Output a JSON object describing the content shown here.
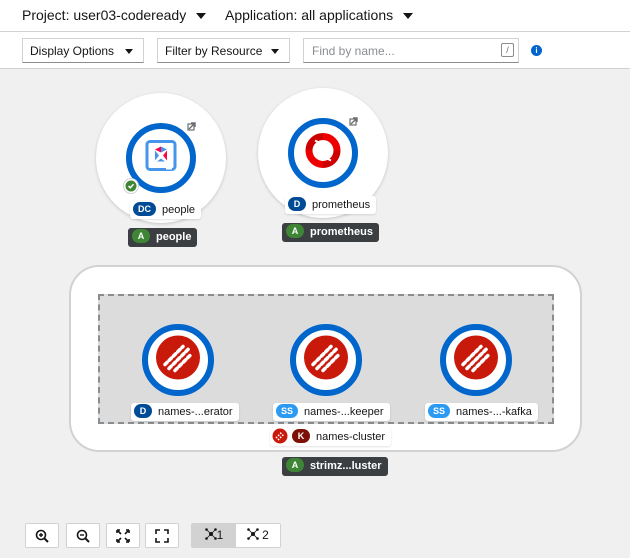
{
  "header": {
    "project_label": "Project: user03-codeready",
    "application_label": "Application: all applications"
  },
  "toolbar": {
    "display_options": "Display Options",
    "filter_by_resource": "Filter by Resource",
    "search_placeholder": "Find by name...",
    "search_shortcut": "/",
    "info_icon": "info-circle-icon"
  },
  "nodes": [
    {
      "id": "people",
      "kind_badge": "DC",
      "name": "people",
      "app_badge": "A",
      "app_name": "people",
      "icon": "quarkus-icon",
      "status": "success",
      "status_icon": "check-circle-icon",
      "has_external_link": true
    },
    {
      "id": "prometheus",
      "kind_badge": "D",
      "name": "prometheus",
      "app_badge": "A",
      "app_name": "prometheus",
      "icon": "openshift-icon",
      "has_external_link": true
    }
  ],
  "group": {
    "kind_badge": "K",
    "name": "names-cluster",
    "app_badge": "A",
    "app_name": "strimz...luster",
    "icon": "strimzi-icon",
    "members": [
      {
        "kind_badge": "D",
        "name": "names-...erator",
        "icon": "strimzi-icon"
      },
      {
        "kind_badge": "SS",
        "name": "names-...keeper",
        "icon": "strimzi-icon"
      },
      {
        "kind_badge": "SS",
        "name": "names-...-kafka",
        "icon": "strimzi-icon"
      }
    ]
  },
  "controls": {
    "zoom_in_icon": "search-plus-icon",
    "zoom_out_icon": "search-minus-icon",
    "fit_icon": "expand-arrows-icon",
    "reset_icon": "expand-icon",
    "layout1_label": "1",
    "layout2_label": "2"
  },
  "colors": {
    "ring": "#0066cc",
    "strimzi_red": "#c9190b",
    "app_tag_bg": "#3c3f42",
    "badge_a": "#3e8635",
    "badge_d": "#004b95",
    "badge_ss": "#2b9af3",
    "badge_k": "#7d1007"
  }
}
